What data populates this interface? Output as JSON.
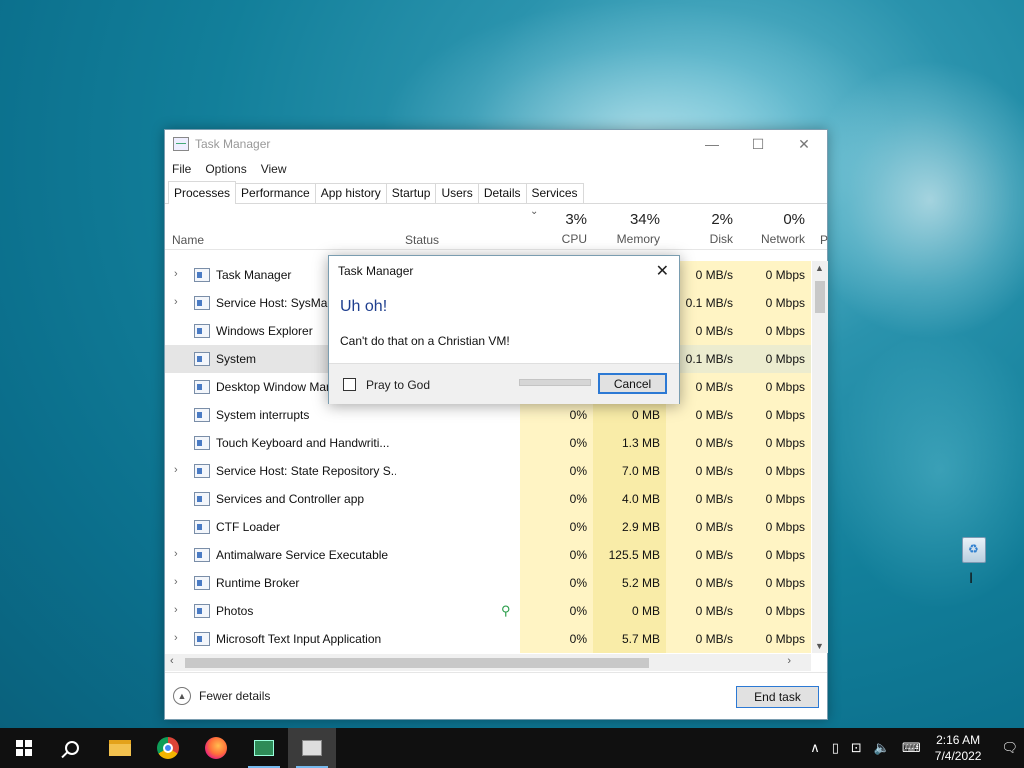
{
  "taskmanager": {
    "title": "Task Manager",
    "menu": [
      "File",
      "Options",
      "View"
    ],
    "tabs": [
      "Processes",
      "Performance",
      "App history",
      "Startup",
      "Users",
      "Details",
      "Services"
    ],
    "columns": {
      "name": "Name",
      "status": "Status",
      "cpu_pct": "3%",
      "cpu": "CPU",
      "mem_pct": "34%",
      "mem": "Memory",
      "disk_pct": "2%",
      "disk": "Disk",
      "net_pct": "0%",
      "net": "Network",
      "power": "P"
    },
    "rows": [
      {
        "name": "Task Manager",
        "cpu": "",
        "mem": "",
        "disk": "0 MB/s",
        "net": "0 Mbps"
      },
      {
        "name": "Service Host: SysMain",
        "cpu": "",
        "mem": "",
        "disk": "0.1 MB/s",
        "net": "0 Mbps"
      },
      {
        "name": "Windows Explorer",
        "cpu": "",
        "mem": "",
        "disk": "0 MB/s",
        "net": "0 Mbps"
      },
      {
        "name": "System",
        "cpu": "",
        "mem": "",
        "disk": "0.1 MB/s",
        "net": "0 Mbps"
      },
      {
        "name": "Desktop Window Manager",
        "cpu": "",
        "mem": "",
        "disk": "0 MB/s",
        "net": "0 Mbps"
      },
      {
        "name": "System interrupts",
        "cpu": "0%",
        "mem": "0 MB",
        "disk": "0 MB/s",
        "net": "0 Mbps"
      },
      {
        "name": "Touch Keyboard and Handwriti...",
        "cpu": "0%",
        "mem": "1.3 MB",
        "disk": "0 MB/s",
        "net": "0 Mbps"
      },
      {
        "name": "Service Host: State Repository S...",
        "cpu": "0%",
        "mem": "7.0 MB",
        "disk": "0 MB/s",
        "net": "0 Mbps"
      },
      {
        "name": "Services and Controller app",
        "cpu": "0%",
        "mem": "4.0 MB",
        "disk": "0 MB/s",
        "net": "0 Mbps"
      },
      {
        "name": "CTF Loader",
        "cpu": "0%",
        "mem": "2.9 MB",
        "disk": "0 MB/s",
        "net": "0 Mbps"
      },
      {
        "name": "Antimalware Service Executable",
        "cpu": "0%",
        "mem": "125.5 MB",
        "disk": "0 MB/s",
        "net": "0 Mbps"
      },
      {
        "name": "Runtime Broker",
        "cpu": "0%",
        "mem": "5.2 MB",
        "disk": "0 MB/s",
        "net": "0 Mbps"
      },
      {
        "name": "Photos",
        "cpu": "0%",
        "mem": "0 MB",
        "disk": "0 MB/s",
        "net": "0 Mbps"
      },
      {
        "name": "Microsoft Text Input Application",
        "cpu": "0%",
        "mem": "5.7 MB",
        "disk": "0 MB/s",
        "net": "0 Mbps"
      }
    ],
    "fewer_details": "Fewer details",
    "end_task": "End task"
  },
  "dialog": {
    "title": "Task Manager",
    "heading": "Uh oh!",
    "message": "Can't do that on a Christian VM!",
    "checkbox_label": "Pray to God",
    "cancel": "Cancel"
  },
  "taskbar": {
    "time": "2:16 AM",
    "date": "7/4/2022"
  },
  "colors": {
    "heading_blue": "#1f3f8f",
    "button_accent": "#2c79d4",
    "cpu_col": "#fff4c4",
    "mem_col": "#f9eca8"
  }
}
